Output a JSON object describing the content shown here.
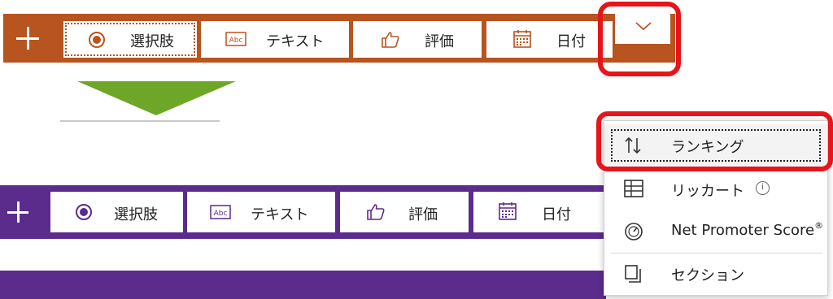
{
  "toolbar_top": {
    "accent": "#b7541f",
    "add_icon": "plus-icon",
    "items": [
      {
        "label": "選択肢",
        "icon": "radio-icon"
      },
      {
        "label": "テキスト",
        "icon": "text-abc-icon"
      },
      {
        "label": "評価",
        "icon": "thumbs-up-icon"
      },
      {
        "label": "日付",
        "icon": "calendar-icon"
      }
    ],
    "more_icon": "chevron-down-icon"
  },
  "toolbar_bottom": {
    "accent": "#5b2c8c",
    "add_icon": "plus-icon",
    "items": [
      {
        "label": "選択肢",
        "icon": "radio-icon"
      },
      {
        "label": "テキスト",
        "icon": "text-abc-icon"
      },
      {
        "label": "評価",
        "icon": "thumbs-up-icon"
      },
      {
        "label": "日付",
        "icon": "calendar-icon"
      }
    ]
  },
  "dropdown": {
    "items": [
      {
        "label": "ランキング",
        "icon": "sort-arrows-icon",
        "selected": true
      },
      {
        "label": "リッカート",
        "icon": "grid-icon",
        "info_icon": "info-icon"
      },
      {
        "label": "Net Promoter Score",
        "suffix": "®",
        "icon": "gauge-icon"
      },
      {
        "label": "セクション",
        "icon": "section-copy-icon"
      }
    ]
  },
  "highlight_color": "#e8141b",
  "arrow_color": "#6ea628"
}
